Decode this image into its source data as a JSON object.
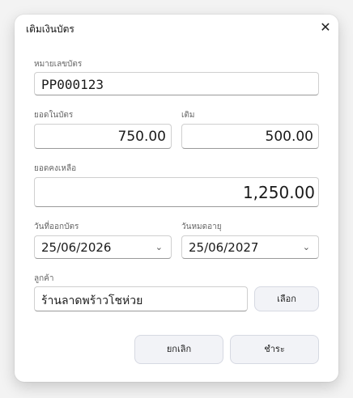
{
  "dialog": {
    "title": "เติมเงินบัตร",
    "close_icon": "close-icon"
  },
  "card_number": {
    "label": "หมายเลขบัตร",
    "value": "PP000123"
  },
  "balance": {
    "label": "ยอดในบัตร",
    "value": "750.00"
  },
  "topup": {
    "label": "เติม",
    "value": "500.00"
  },
  "remaining": {
    "label": "ยอดคงเหลือ",
    "value": "1,250.00"
  },
  "issue_date": {
    "label": "วันที่ออกบัตร",
    "value": "25/06/2026"
  },
  "expiry_date": {
    "label": "วันหมดอายุ",
    "value": "25/06/2027"
  },
  "customer": {
    "label": "ลูกค้า",
    "value": "ร้านลาดพร้าวโชห่วย",
    "select_label": "เลือก"
  },
  "actions": {
    "cancel_label": "ยกเลิก",
    "pay_label": "ชำระ"
  }
}
